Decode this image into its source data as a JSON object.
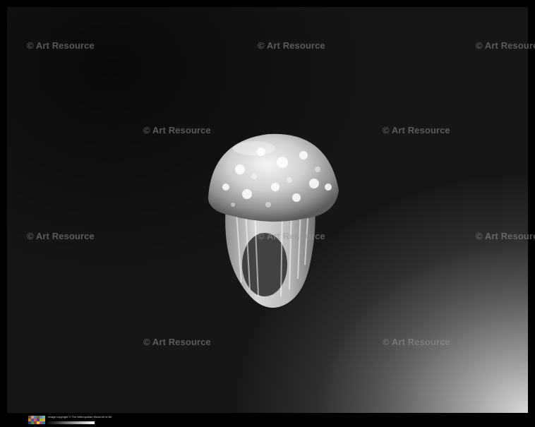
{
  "watermark": {
    "text": "© Art Resource"
  },
  "footer": {
    "copyright": "Image copyright © The Metropolitan Museum of Art"
  },
  "colors": {
    "background": "#000000",
    "photo_dark": "#161616",
    "photo_light": "#d8d8d8",
    "watermark": "#969696"
  }
}
